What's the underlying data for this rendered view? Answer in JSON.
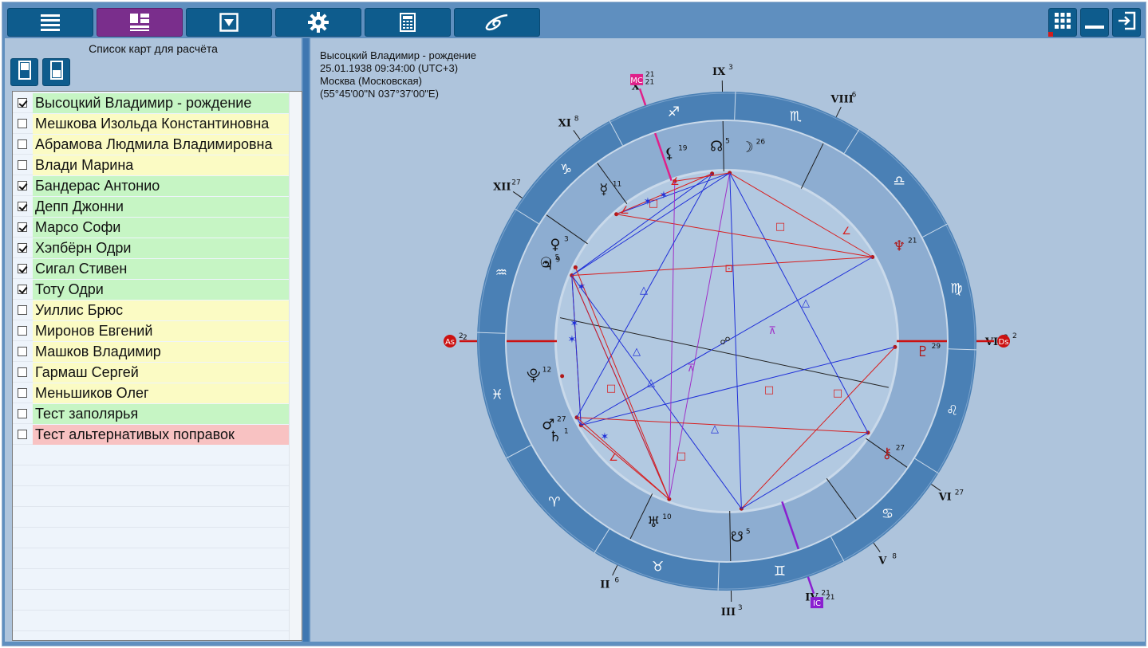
{
  "toolbar": {
    "buttons": [
      {
        "icon": "list-icon",
        "active": false
      },
      {
        "icon": "layout-icon",
        "active": true
      },
      {
        "icon": "dropdown-box-icon",
        "active": false
      },
      {
        "icon": "gear-icon",
        "active": false
      },
      {
        "icon": "calculator-icon",
        "active": false
      },
      {
        "icon": "galaxy-icon",
        "active": false
      }
    ],
    "right_buttons": [
      "apps-grid-icon",
      "minimize-icon",
      "exit-icon"
    ]
  },
  "left_panel": {
    "title": "Список карт для расчёта",
    "buttons": [
      "column-view-icon",
      "column-view-alt-icon"
    ],
    "charts": [
      {
        "name": "Высоцкий Владимир - рождение",
        "checked": true,
        "color": "green"
      },
      {
        "name": "Мешкова Изольда Константиновна",
        "checked": false,
        "color": "yellow"
      },
      {
        "name": "Абрамова Людмила Владимировна",
        "checked": false,
        "color": "yellow"
      },
      {
        "name": "Влади Марина",
        "checked": false,
        "color": "yellow"
      },
      {
        "name": "Бандерас Антонио",
        "checked": true,
        "color": "green"
      },
      {
        "name": "Депп Джонни",
        "checked": true,
        "color": "green"
      },
      {
        "name": "Марсо Софи",
        "checked": true,
        "color": "green"
      },
      {
        "name": "Хэпбёрн Одри",
        "checked": true,
        "color": "green"
      },
      {
        "name": "Сигал Стивен",
        "checked": true,
        "color": "green"
      },
      {
        "name": "Тоту Одри",
        "checked": true,
        "color": "green"
      },
      {
        "name": "Уиллис Брюс",
        "checked": false,
        "color": "yellow"
      },
      {
        "name": "Миронов Евгений",
        "checked": false,
        "color": "yellow"
      },
      {
        "name": "Машков Владимир",
        "checked": false,
        "color": "yellow"
      },
      {
        "name": "Гармаш Сергей",
        "checked": false,
        "color": "yellow"
      },
      {
        "name": "Меньшиков Олег",
        "checked": false,
        "color": "yellow"
      },
      {
        "name": "Тест заполярья",
        "checked": false,
        "color": "green"
      },
      {
        "name": "Тест альтернативых поправок",
        "checked": false,
        "color": "red"
      }
    ]
  },
  "chart_info": {
    "title": "Высоцкий Владимир - рождение",
    "datetime": "25.01.1938 09:34:00 (UTC+3)",
    "place": "Москва (Московская)",
    "coords": "(55°45'00\"N 037°37'00\"E)"
  },
  "wheel": {
    "ascendant_degree_in_sign": 2,
    "angles": [
      {
        "label": "As",
        "degree": "2",
        "color": "#cc1111"
      },
      {
        "label": "Ds",
        "degree": "2",
        "color": "#cc1111"
      },
      {
        "label": "MC",
        "degree": "21",
        "color": "#e0208a"
      },
      {
        "label": "IC",
        "degree": "21",
        "color": "#8a1fd0"
      }
    ],
    "signs": [
      "♓",
      "♈",
      "♉",
      "♊",
      "♋",
      "♌",
      "♍",
      "♎",
      "♏",
      "♐",
      "♑",
      "♒"
    ],
    "houses": [
      {
        "num": "I",
        "degree": "2"
      },
      {
        "num": "II",
        "degree": "6"
      },
      {
        "num": "III",
        "degree": "3"
      },
      {
        "num": "IV",
        "degree": "21"
      },
      {
        "num": "V",
        "degree": "8"
      },
      {
        "num": "VI",
        "degree": "27"
      },
      {
        "num": "VII",
        "degree": "2"
      },
      {
        "num": "VIII",
        "degree": "6"
      },
      {
        "num": "IX",
        "degree": "3"
      },
      {
        "num": "X",
        "degree": "21"
      },
      {
        "num": "XI",
        "degree": "8"
      },
      {
        "num": "XII",
        "degree": "27"
      }
    ],
    "planets": [
      {
        "glyph": "☉",
        "degree": "5",
        "name": "Sun"
      },
      {
        "glyph": "♀",
        "degree": "3",
        "name": "Venus"
      },
      {
        "glyph": "♃",
        "degree": "9",
        "name": "Jupiter"
      },
      {
        "glyph": "☿",
        "degree": "11",
        "name": "Mercury"
      },
      {
        "glyph": "⚸",
        "degree": "19",
        "name": "Lilith"
      },
      {
        "glyph": "☊",
        "degree": "5",
        "name": "North Node"
      },
      {
        "glyph": "☽",
        "degree": "26",
        "name": "Moon"
      },
      {
        "glyph": "♆",
        "degree": "21",
        "name": "Neptune"
      },
      {
        "glyph": "♇",
        "degree": "29",
        "name": "Pluto"
      },
      {
        "glyph": "⚷",
        "degree": "27",
        "name": "Chiron"
      },
      {
        "glyph": "☋",
        "degree": "5",
        "name": "South Node"
      },
      {
        "glyph": "♅",
        "degree": "10",
        "name": "Uranus"
      },
      {
        "glyph": "♄",
        "degree": "1",
        "name": "Saturn"
      },
      {
        "glyph": "♂",
        "degree": "27",
        "name": "Mars"
      },
      {
        "glyph": "⯓",
        "degree": "12",
        "name": "Proserpina"
      }
    ]
  }
}
